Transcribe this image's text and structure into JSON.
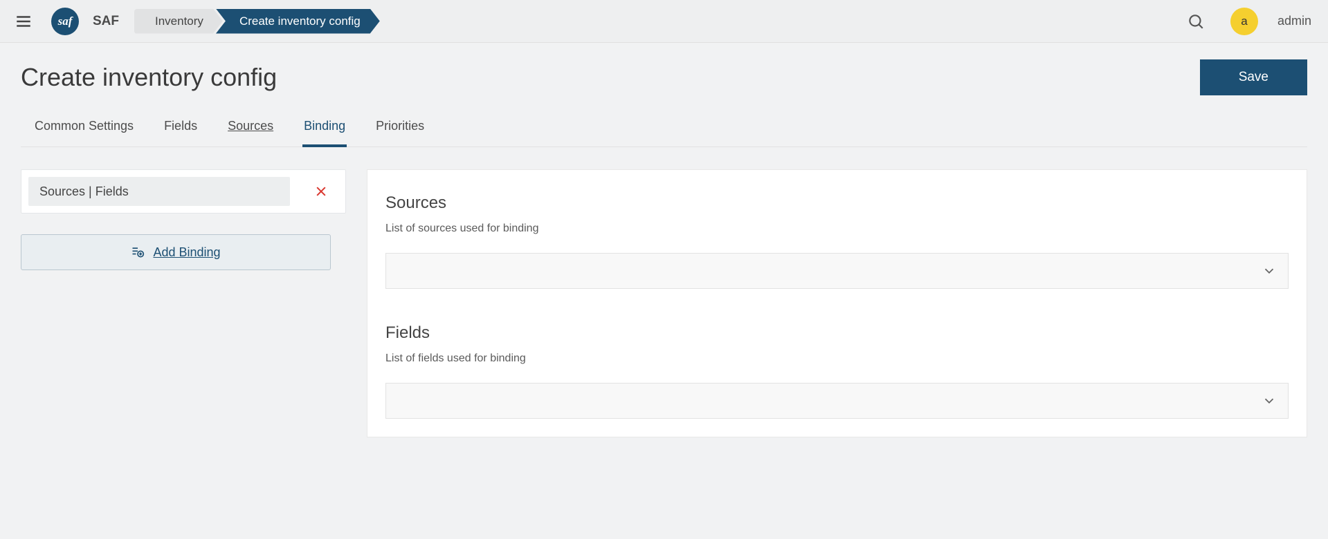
{
  "header": {
    "app_name": "SAF",
    "logo_text": "saf",
    "breadcrumbs": {
      "inventory": "Inventory",
      "current": "Create inventory config"
    },
    "avatar_letter": "a",
    "username": "admin"
  },
  "page": {
    "title": "Create inventory config",
    "save_label": "Save"
  },
  "tabs": {
    "common": "Common Settings",
    "fields": "Fields",
    "sources": "Sources",
    "binding": "Binding",
    "priorities": "Priorities"
  },
  "left": {
    "binding_item_label": "Sources | Fields",
    "add_binding_label": "Add Binding"
  },
  "right": {
    "sources_title": "Sources",
    "sources_subtitle": "List of sources used for binding",
    "fields_title": "Fields",
    "fields_subtitle": "List of fields used for binding"
  }
}
